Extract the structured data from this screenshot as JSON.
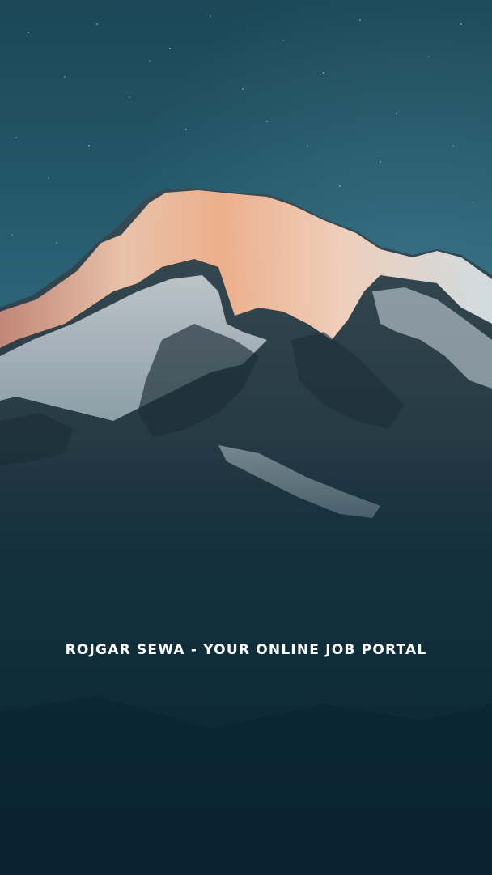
{
  "app": {
    "splash_title": "ROJGAR SEWA - YOUR ONLINE JOB PORTAL"
  },
  "background": {
    "image": "mountain-peak-photo",
    "colors": {
      "sky": "#24576a",
      "sky_dark": "#0b2431",
      "peak_highlight": "#f3b08a",
      "snow": "#e6edf0",
      "rock": "#22333c"
    }
  }
}
